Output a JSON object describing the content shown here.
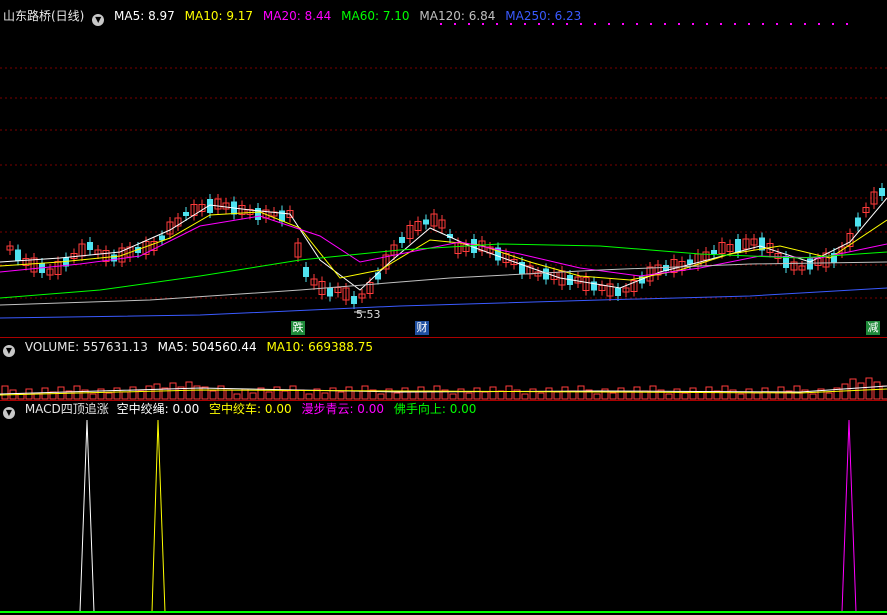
{
  "price_header": {
    "title": "山东路桥(日线)",
    "indicators": [
      {
        "text": "MA5: 8.97",
        "color": "#ffffff"
      },
      {
        "text": "MA10: 9.17",
        "color": "#ffff00"
      },
      {
        "text": "MA20: 8.44",
        "color": "#ff00ff"
      },
      {
        "text": "MA60: 7.10",
        "color": "#00ff00"
      },
      {
        "text": "MA120: 6.84",
        "color": "#c0c0c0"
      },
      {
        "text": "MA250: 6.23",
        "color": "#3a5aff"
      }
    ]
  },
  "price_chart": {
    "low_label": "5.53",
    "calendar_marks": [
      {
        "label": "跌",
        "bg": "#1f8a3a"
      },
      {
        "label": "财",
        "bg": "#1f4fa0"
      },
      {
        "label": "减",
        "bg": "#1f8a3a"
      }
    ]
  },
  "volume_header": {
    "title": "VOLUME: 557631.13",
    "indicators": [
      {
        "text": "MA5: 504560.44",
        "color": "#ffffff"
      },
      {
        "text": "MA10: 669388.75",
        "color": "#ffff00"
      }
    ]
  },
  "macd_header": {
    "title": "MACD四顶追涨",
    "indicators": [
      {
        "text": "空中绞绳: 0.00",
        "color": "#ffffff"
      },
      {
        "text": "空中绞车: 0.00",
        "color": "#ffff00"
      },
      {
        "text": "漫步青云: 0.00",
        "color": "#ff00ff"
      },
      {
        "text": "佛手向上: 0.00",
        "color": "#00ff00"
      }
    ]
  },
  "colors": {
    "up": "#ff3b3b",
    "down": "#4fe3f0",
    "grid": "#aa0000",
    "bg": "#000000"
  }
}
